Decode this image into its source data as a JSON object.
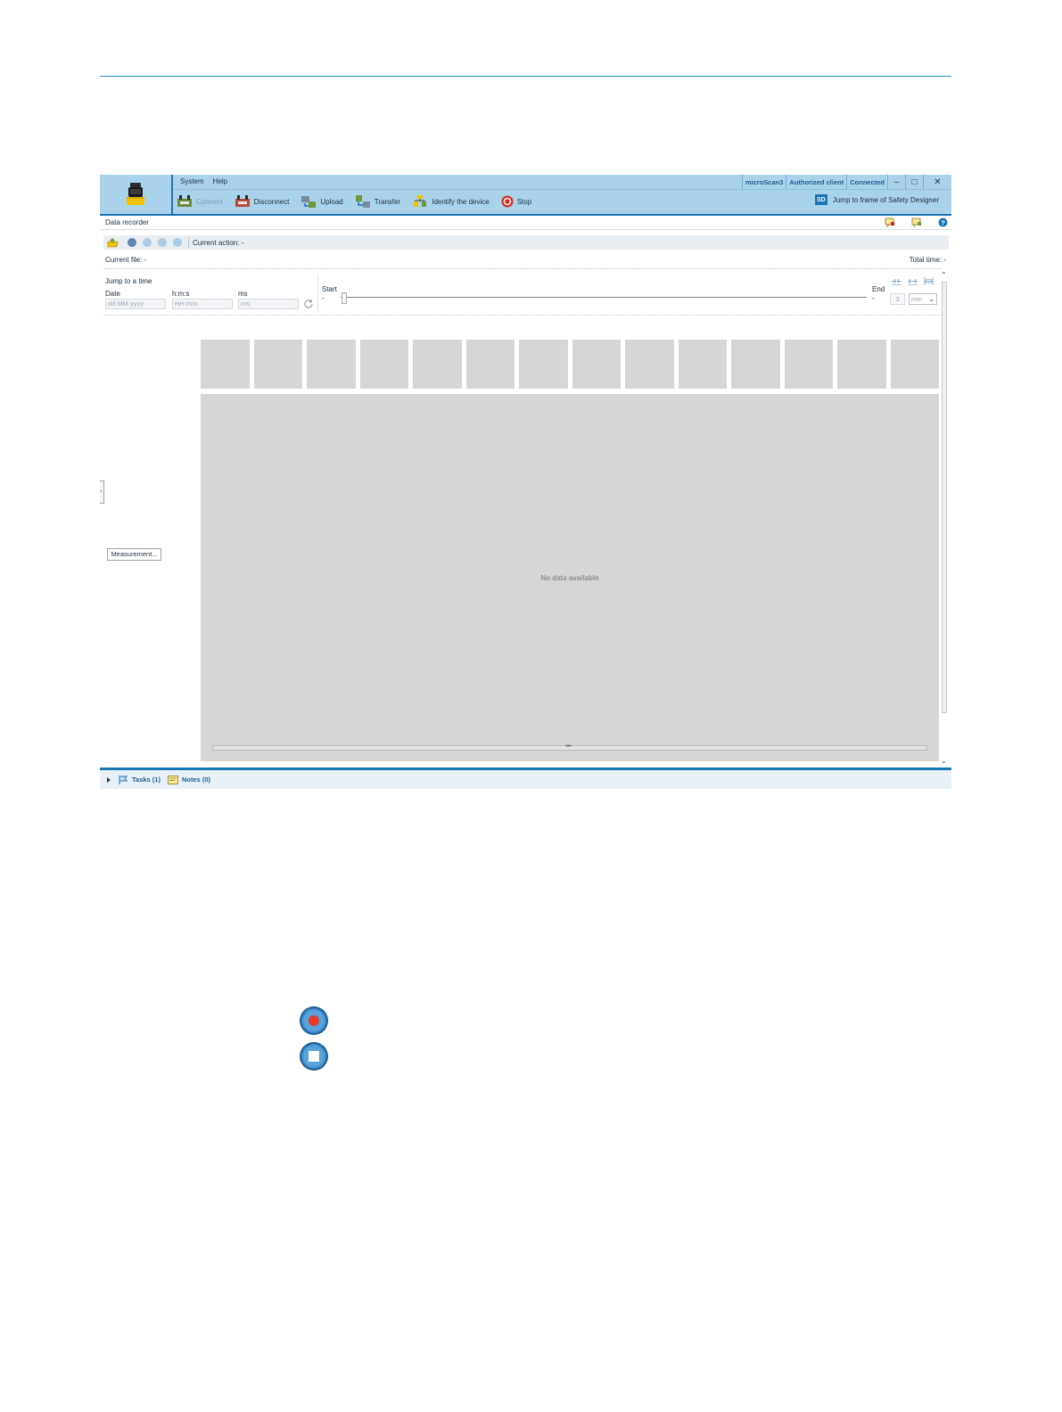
{
  "app": {
    "menu": [
      "System",
      "Help"
    ],
    "status": {
      "device": "microScan3",
      "user_level": "Authorized client",
      "connection": "Connected"
    },
    "window_buttons": {
      "minimize": "–",
      "maximize": "□",
      "close": "✕"
    },
    "toolbar": {
      "connect": "Connect",
      "disconnect": "Disconnect",
      "upload": "Upload",
      "transfer": "Transfer",
      "identify": "Identify the device",
      "stop": "Stop",
      "jump_frame": "Jump to frame of Safety Designer",
      "sd_badge": "SD"
    }
  },
  "data_recorder": {
    "title": "Data recorder",
    "current_action": "Current action: -",
    "current_file": "Current file: -",
    "total_time": "Total time: -",
    "jump": {
      "title": "Jump to a time",
      "date_label": "Date",
      "date_placeholder": "dd.MM.yyyy",
      "hms_label": "h:m:s",
      "hms_placeholder": "HH:mm",
      "ms_label": "ms",
      "ms_placeholder": "ms"
    },
    "timeline": {
      "start_label": "Start",
      "start_value": "-",
      "end_label": "End",
      "end_value": "-",
      "zoom_value": "3",
      "zoom_unit": "min"
    },
    "no_data": "No data available",
    "measurement_button": "Measurement..."
  },
  "bottom": {
    "tasks": "Tasks (1)",
    "notes": "Notes (0)"
  },
  "colors": {
    "title_bg": "#a9d3ea",
    "accent": "#1b75b3",
    "record_red": "#e8392b",
    "panel_gray": "#d6d6d6"
  }
}
